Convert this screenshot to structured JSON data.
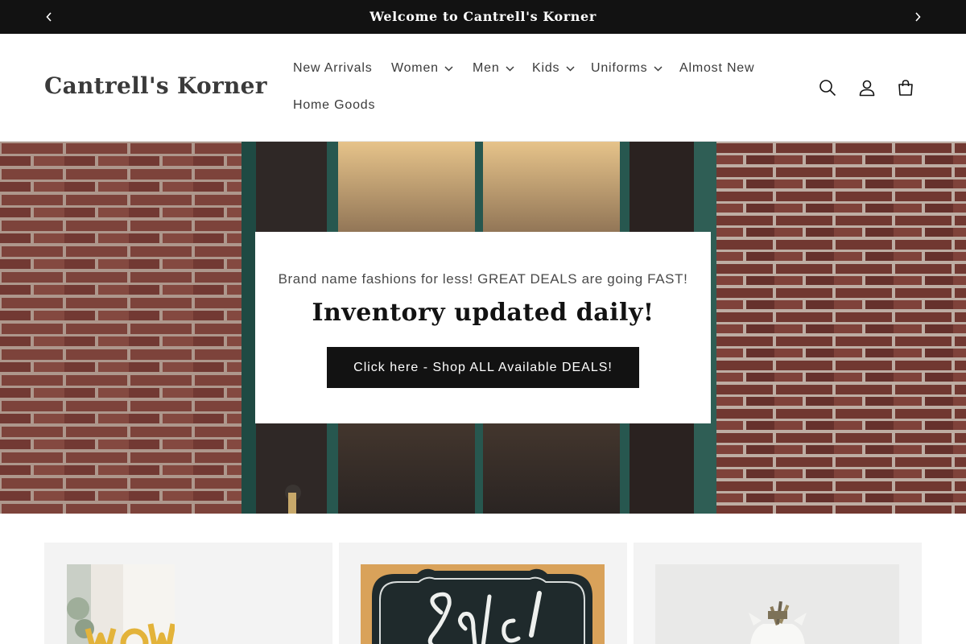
{
  "announcement": {
    "text": "Welcome to Cantrell's Korner",
    "prev_icon": "chevron-left-icon",
    "next_icon": "chevron-right-icon"
  },
  "header": {
    "logo": "Cantrell's Korner",
    "nav": [
      {
        "label": "New Arrivals",
        "has_dropdown": false
      },
      {
        "label": "Women",
        "has_dropdown": true
      },
      {
        "label": "Men",
        "has_dropdown": true
      },
      {
        "label": "Kids",
        "has_dropdown": true
      },
      {
        "label": "Uniforms",
        "has_dropdown": true
      },
      {
        "label": "Almost New",
        "has_dropdown": false
      },
      {
        "label": "Home Goods",
        "has_dropdown": false
      }
    ],
    "icons": [
      "search-icon",
      "account-icon",
      "cart-icon"
    ]
  },
  "hero": {
    "subtitle": "Brand name fashions for less! GREAT DEALS are going FAST!",
    "title": "Inventory updated daily!",
    "button_label": "Click here - Shop ALL Available DEALS!"
  },
  "collections": [
    {
      "image": "wow-balloons-image"
    },
    {
      "image": "sale-chalkboard-image"
    },
    {
      "image": "piggy-bank-image"
    }
  ],
  "colors": {
    "announcement_bg": "#121212",
    "button_bg": "#121212",
    "card_bg": "#f3f3f3",
    "text": "#121212"
  }
}
